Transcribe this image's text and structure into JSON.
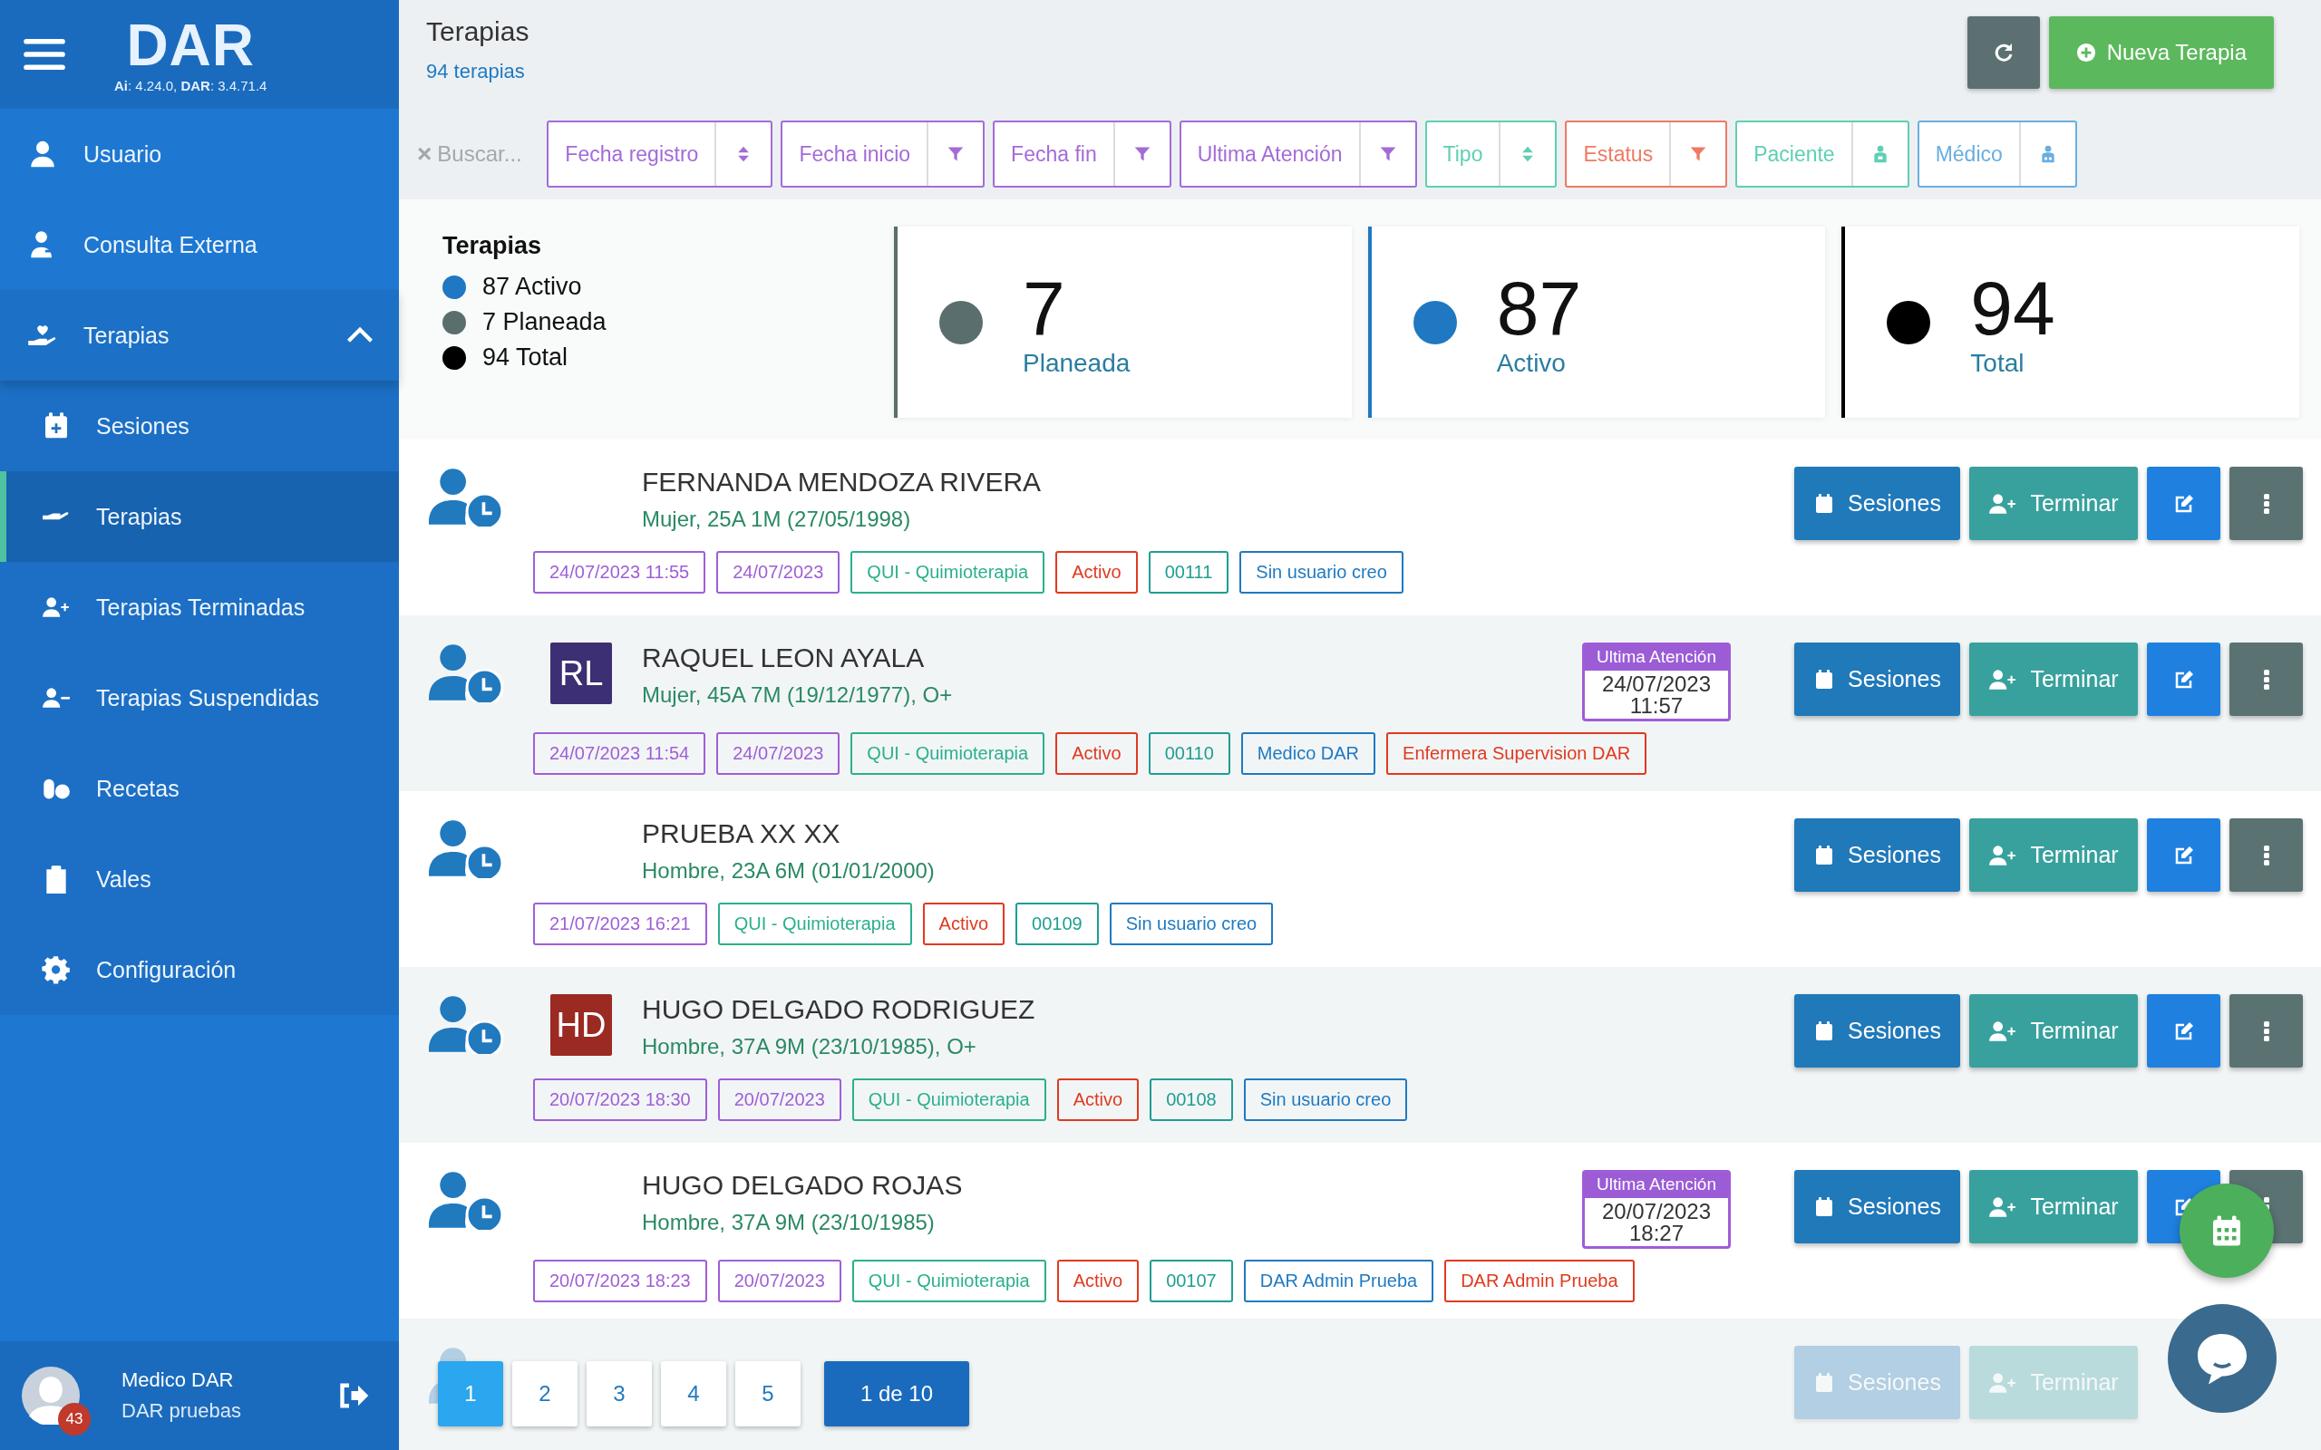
{
  "sidebar": {
    "logo": "DAR",
    "version": "**Ai**: 4.24.0, **DAR**: 3.4.71.4",
    "items": [
      {
        "label": "Usuario",
        "selected": false
      },
      {
        "label": "Consulta Externa",
        "selected": false
      },
      {
        "label": "Terapias",
        "selected": false,
        "expanded": true,
        "children": [
          {
            "label": "Sesiones",
            "selected": false
          },
          {
            "label": "Terapias",
            "selected": true
          },
          {
            "label": "Terapias Terminadas",
            "selected": false
          },
          {
            "label": "Terapias Suspendidas",
            "selected": false
          },
          {
            "label": "Recetas",
            "selected": false
          },
          {
            "label": "Vales",
            "selected": false
          },
          {
            "label": "Configuración",
            "selected": false
          }
        ]
      }
    ],
    "user": {
      "name": "Medico DAR",
      "subtitle": "DAR pruebas",
      "badge": "43"
    }
  },
  "header": {
    "title": "Terapias",
    "count": "94 terapias",
    "new_button": "Nueva Terapia"
  },
  "search": {
    "clear": "×",
    "placeholder": "Buscar..."
  },
  "filters": [
    {
      "label": "Fecha registro",
      "kind": "sort",
      "color": "#a46bd8"
    },
    {
      "label": "Fecha inicio",
      "kind": "filter",
      "color": "#a46bd8"
    },
    {
      "label": "Fecha fin",
      "kind": "filter",
      "color": "#a46bd8"
    },
    {
      "label": "Ultima Atención",
      "kind": "filter",
      "color": "#a46bd8"
    },
    {
      "label": "Tipo",
      "kind": "sort",
      "color": "#5fcfb3"
    },
    {
      "label": "Estatus",
      "kind": "filter",
      "color": "#ef7a63"
    },
    {
      "label": "Paciente",
      "kind": "patient",
      "color": "#5fcfb3"
    },
    {
      "label": "Médico",
      "kind": "doctor",
      "color": "#6aaee0"
    }
  ],
  "summary": {
    "title": "Terapias",
    "legend": [
      {
        "label": "87 Activo",
        "color": "#1f78c1"
      },
      {
        "label": "7 Planeada",
        "color": "#5a6e6e"
      },
      {
        "label": "94 Total",
        "color": "#000000"
      }
    ]
  },
  "stats": [
    {
      "value": "7",
      "label": "Planeada",
      "color": "#5a6e6e"
    },
    {
      "value": "87",
      "label": "Activo",
      "color": "#1f78c1"
    },
    {
      "value": "94",
      "label": "Total",
      "color": "#000000"
    }
  ],
  "rows": [
    {
      "name": "FERNANDA MENDOZA RIVERA",
      "details": "Mujer, 25A 1M (27/05/1998)",
      "tags": [
        {
          "text": "24/07/2023 11:55",
          "color": "#9f5fd6"
        },
        {
          "text": "24/07/2023",
          "color": "#9f5fd6"
        },
        {
          "text": "QUI - Quimioterapia",
          "color": "#2bb08d"
        },
        {
          "text": "Activo",
          "color": "#e03a1f"
        },
        {
          "text": "00111",
          "color": "#1e9e92"
        },
        {
          "text": "Sin usuario creo",
          "color": "#1f7ac2"
        }
      ],
      "buttons": [
        "Sesiones",
        "Terminar"
      ]
    },
    {
      "name": "RAQUEL LEON AYALA",
      "avatar": {
        "initials": "RL",
        "color": "#3d2f73"
      },
      "details": "Mujer, 45A 7M (19/12/1977), O+",
      "last_visit": {
        "label": "Ultima Atención",
        "date": "24/07/2023",
        "time": "11:57"
      },
      "tags": [
        {
          "text": "24/07/2023 11:54",
          "color": "#9f5fd6"
        },
        {
          "text": "24/07/2023",
          "color": "#9f5fd6"
        },
        {
          "text": "QUI - Quimioterapia",
          "color": "#2bb08d"
        },
        {
          "text": "Activo",
          "color": "#e03a1f"
        },
        {
          "text": "00110",
          "color": "#1e9e92"
        },
        {
          "text": "Medico DAR",
          "color": "#1f7ac2"
        },
        {
          "text": "Enfermera Supervision DAR",
          "color": "#e03a1f"
        }
      ],
      "buttons": [
        "Sesiones",
        "Terminar"
      ]
    },
    {
      "name": "PRUEBA XX XX",
      "details": "Hombre, 23A 6M (01/01/2000)",
      "tags": [
        {
          "text": "21/07/2023 16:21",
          "color": "#9f5fd6"
        },
        {
          "text": "QUI - Quimioterapia",
          "color": "#2bb08d"
        },
        {
          "text": "Activo",
          "color": "#e03a1f"
        },
        {
          "text": "00109",
          "color": "#1e9e92"
        },
        {
          "text": "Sin usuario creo",
          "color": "#1f7ac2"
        }
      ],
      "buttons": [
        "Sesiones",
        "Terminar"
      ]
    },
    {
      "name": "HUGO DELGADO RODRIGUEZ",
      "avatar": {
        "initials": "HD",
        "color": "#9b2a22"
      },
      "details": "Hombre, 37A 9M (23/10/1985), O+",
      "tags": [
        {
          "text": "20/07/2023 18:30",
          "color": "#9f5fd6"
        },
        {
          "text": "20/07/2023",
          "color": "#9f5fd6"
        },
        {
          "text": "QUI - Quimioterapia",
          "color": "#2bb08d"
        },
        {
          "text": "Activo",
          "color": "#e03a1f"
        },
        {
          "text": "00108",
          "color": "#1e9e92"
        },
        {
          "text": "Sin usuario creo",
          "color": "#1f7ac2"
        }
      ],
      "buttons": [
        "Sesiones",
        "Terminar"
      ]
    },
    {
      "name": "HUGO DELGADO ROJAS",
      "details": "Hombre, 37A 9M (23/10/1985)",
      "last_visit": {
        "label": "Ultima Atención",
        "date": "20/07/2023",
        "time": "18:27"
      },
      "tags": [
        {
          "text": "20/07/2023 18:23",
          "color": "#9f5fd6"
        },
        {
          "text": "20/07/2023",
          "color": "#9f5fd6"
        },
        {
          "text": "QUI - Quimioterapia",
          "color": "#2bb08d"
        },
        {
          "text": "Activo",
          "color": "#e03a1f"
        },
        {
          "text": "00107",
          "color": "#1e9e92"
        },
        {
          "text": "DAR Admin Prueba",
          "color": "#1f7ac2"
        },
        {
          "text": "DAR Admin Prueba",
          "color": "#e03a1f"
        }
      ],
      "buttons": [
        "Sesiones",
        "Terminar"
      ]
    },
    {
      "kind": "partial",
      "buttons": [
        "Sesiones",
        "Terminar"
      ]
    }
  ],
  "pagination": {
    "pages": [
      {
        "label": "1",
        "selected": true
      },
      {
        "label": "2",
        "selected": false
      },
      {
        "label": "3",
        "selected": false
      },
      {
        "label": "4",
        "selected": false
      },
      {
        "label": "5",
        "selected": false
      }
    ],
    "summary": "1 de 10"
  }
}
